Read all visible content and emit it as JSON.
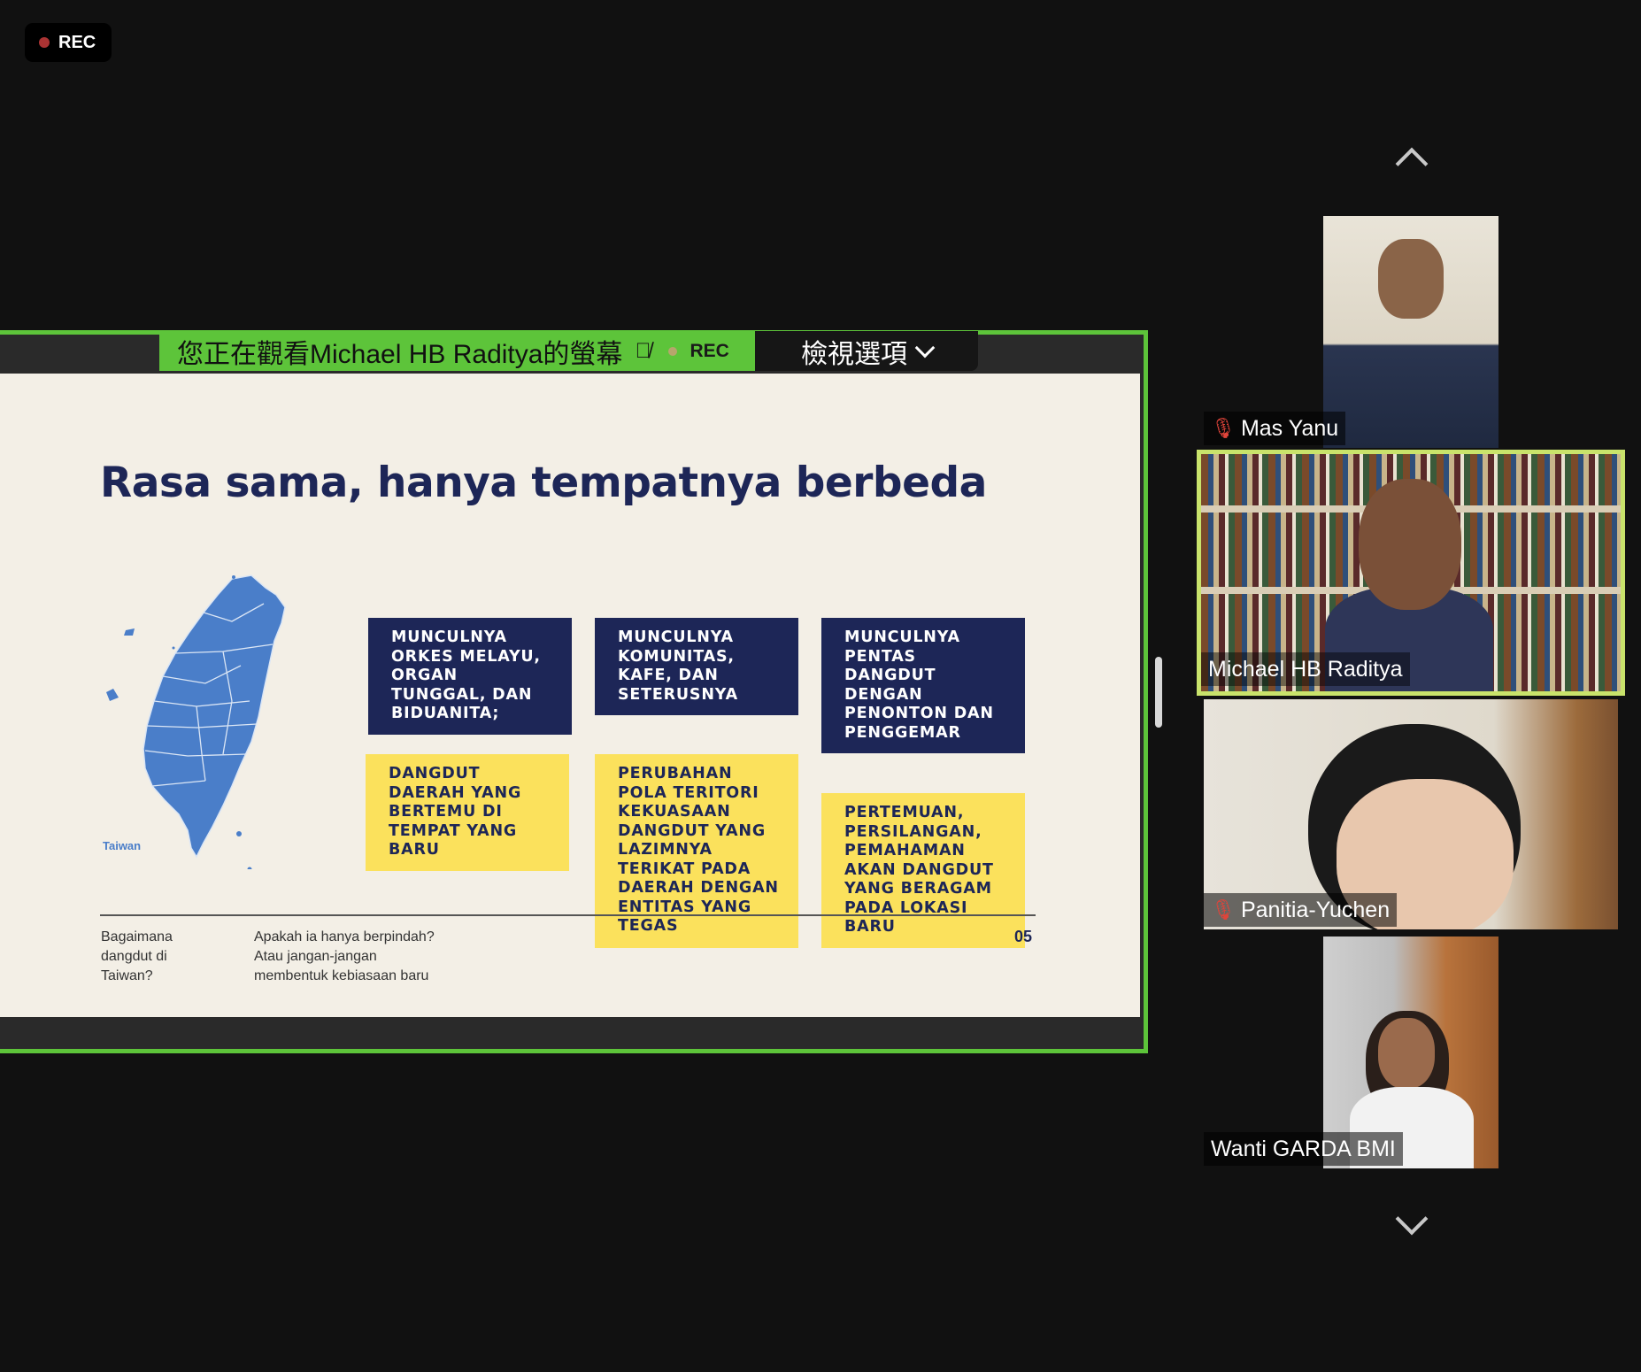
{
  "recording": {
    "label": "REC"
  },
  "share_banner": {
    "text": "您正在觀看Michael HB Raditya的螢幕",
    "rec_label": "REC",
    "view_options_label": "檢視選項"
  },
  "slide": {
    "title": "Rasa sama, hanya tempatnya berbeda",
    "map_label": "Taiwan",
    "boxes": {
      "b1": "MUNCULNYA\nORKES MELAYU,\nORGAN\nTUNGGAL, DAN\nBIDUANITA;",
      "b2": "MUNCULNYA\nKOMUNITAS,\nKAFE, DAN\nSETERUSNYA",
      "b3": "MUNCULNYA\nPENTAS\nDANGDUT\nDENGAN\nPENONTON DAN\nPENGGEMAR",
      "b4": "DANGDUT\nDAERAH YANG\nBERTEMU DI\nTEMPAT YANG\nBARU",
      "b5": "PERUBAHAN\n POLA TERITORI\nKEKUASAAN\nDANGDUT YANG\nLAZIMNYA\nTERIKAT PADA\nDAERAH DENGAN\nENTITAS YANG\nTEGAS",
      "b6": "PERTEMUAN,\nPERSILANGAN,\nPEMAHAMAN\nAKAN DANGDUT\n YANG BERAGAM\nPADA LOKASI\nBARU"
    },
    "footer_left": "Bagaimana\ndangdut di\nTaiwan?",
    "footer_mid": "Apakah ia hanya berpindah?\nAtau jangan-jangan\nmembentuk kebiasaan baru",
    "page_number": "05"
  },
  "participants": [
    {
      "name": "Mas Yanu",
      "muted": true
    },
    {
      "name": "Michael HB Raditya",
      "muted": false,
      "active_speaker": true
    },
    {
      "name": "Panitia-Yuchen",
      "muted": true
    },
    {
      "name": "Wanti GARDA BMI",
      "muted": false
    }
  ],
  "colors": {
    "share_border": "#5dc43a",
    "speaker_highlight": "#c9e36b",
    "slide_navy": "#1d2657",
    "slide_yellow": "#fbe15c",
    "slide_bg": "#f3efe6"
  }
}
